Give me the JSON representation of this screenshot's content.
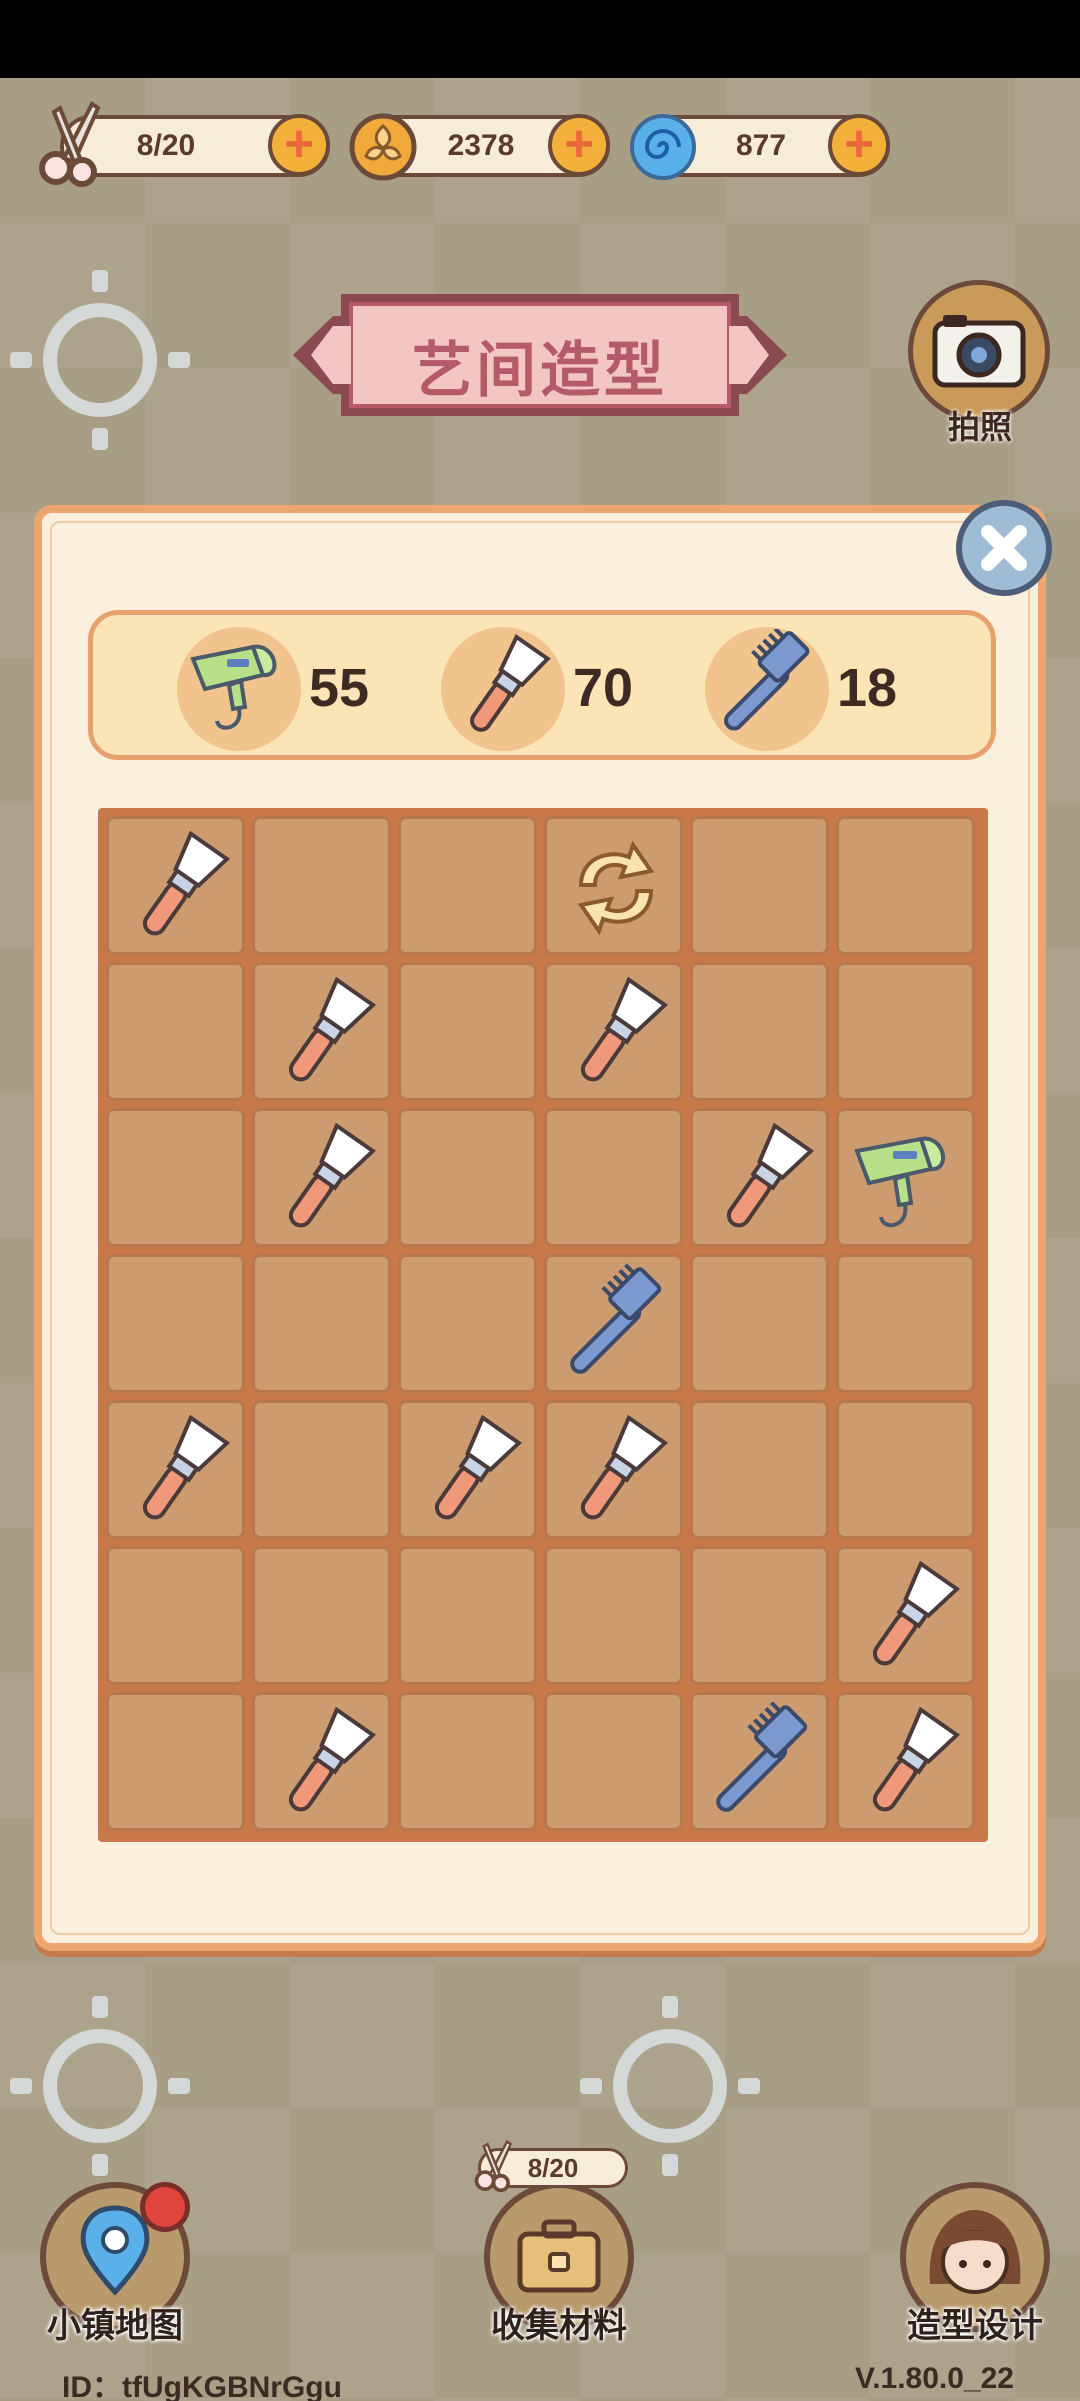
{
  "resources": {
    "scissors": {
      "value": "8/20",
      "icon": "scissors-icon"
    },
    "coins": {
      "value": "2378",
      "icon": "coin-icon"
    },
    "gems": {
      "value": "877",
      "icon": "blue-swirl-icon"
    },
    "plus_symbol": "+"
  },
  "title": "艺间造型",
  "camera": {
    "label": "拍照",
    "icon": "camera-icon"
  },
  "counters": [
    {
      "icon": "hair-dryer-icon",
      "count": "55"
    },
    {
      "icon": "makeup-brush-icon",
      "count": "70"
    },
    {
      "icon": "comb-icon",
      "count": "18"
    }
  ],
  "board": {
    "columns": 6,
    "rows": 7,
    "cells": [
      [
        "brush",
        "",
        "",
        "refresh",
        "",
        ""
      ],
      [
        "",
        "brush",
        "",
        "brush",
        "",
        ""
      ],
      [
        "",
        "brush",
        "",
        "",
        "brush",
        "dryer"
      ],
      [
        "",
        "",
        "",
        "comb",
        "",
        ""
      ],
      [
        "brush",
        "",
        "brush",
        "brush",
        "",
        ""
      ],
      [
        "",
        "",
        "",
        "",
        "",
        "brush"
      ],
      [
        "",
        "brush",
        "",
        "",
        "comb",
        "brush"
      ]
    ]
  },
  "bottom_nav": {
    "map": {
      "label": "小镇地图",
      "icon": "map-pin-icon"
    },
    "collect": {
      "label": "收集材料",
      "icon": "suitcase-icon",
      "count": "8/20"
    },
    "style": {
      "label": "造型设计",
      "icon": "girl-avatar-icon"
    }
  },
  "footer": {
    "id": "ID：tfUgKGBNrGgu",
    "version": "V.1.80.0_22"
  },
  "colors": {
    "panel_bg": "#fbf0dd",
    "panel_border": "#eea670",
    "board_bg": "#c9784a",
    "cell_bg": "#cc9b6f",
    "title_text": "#b45a68"
  }
}
